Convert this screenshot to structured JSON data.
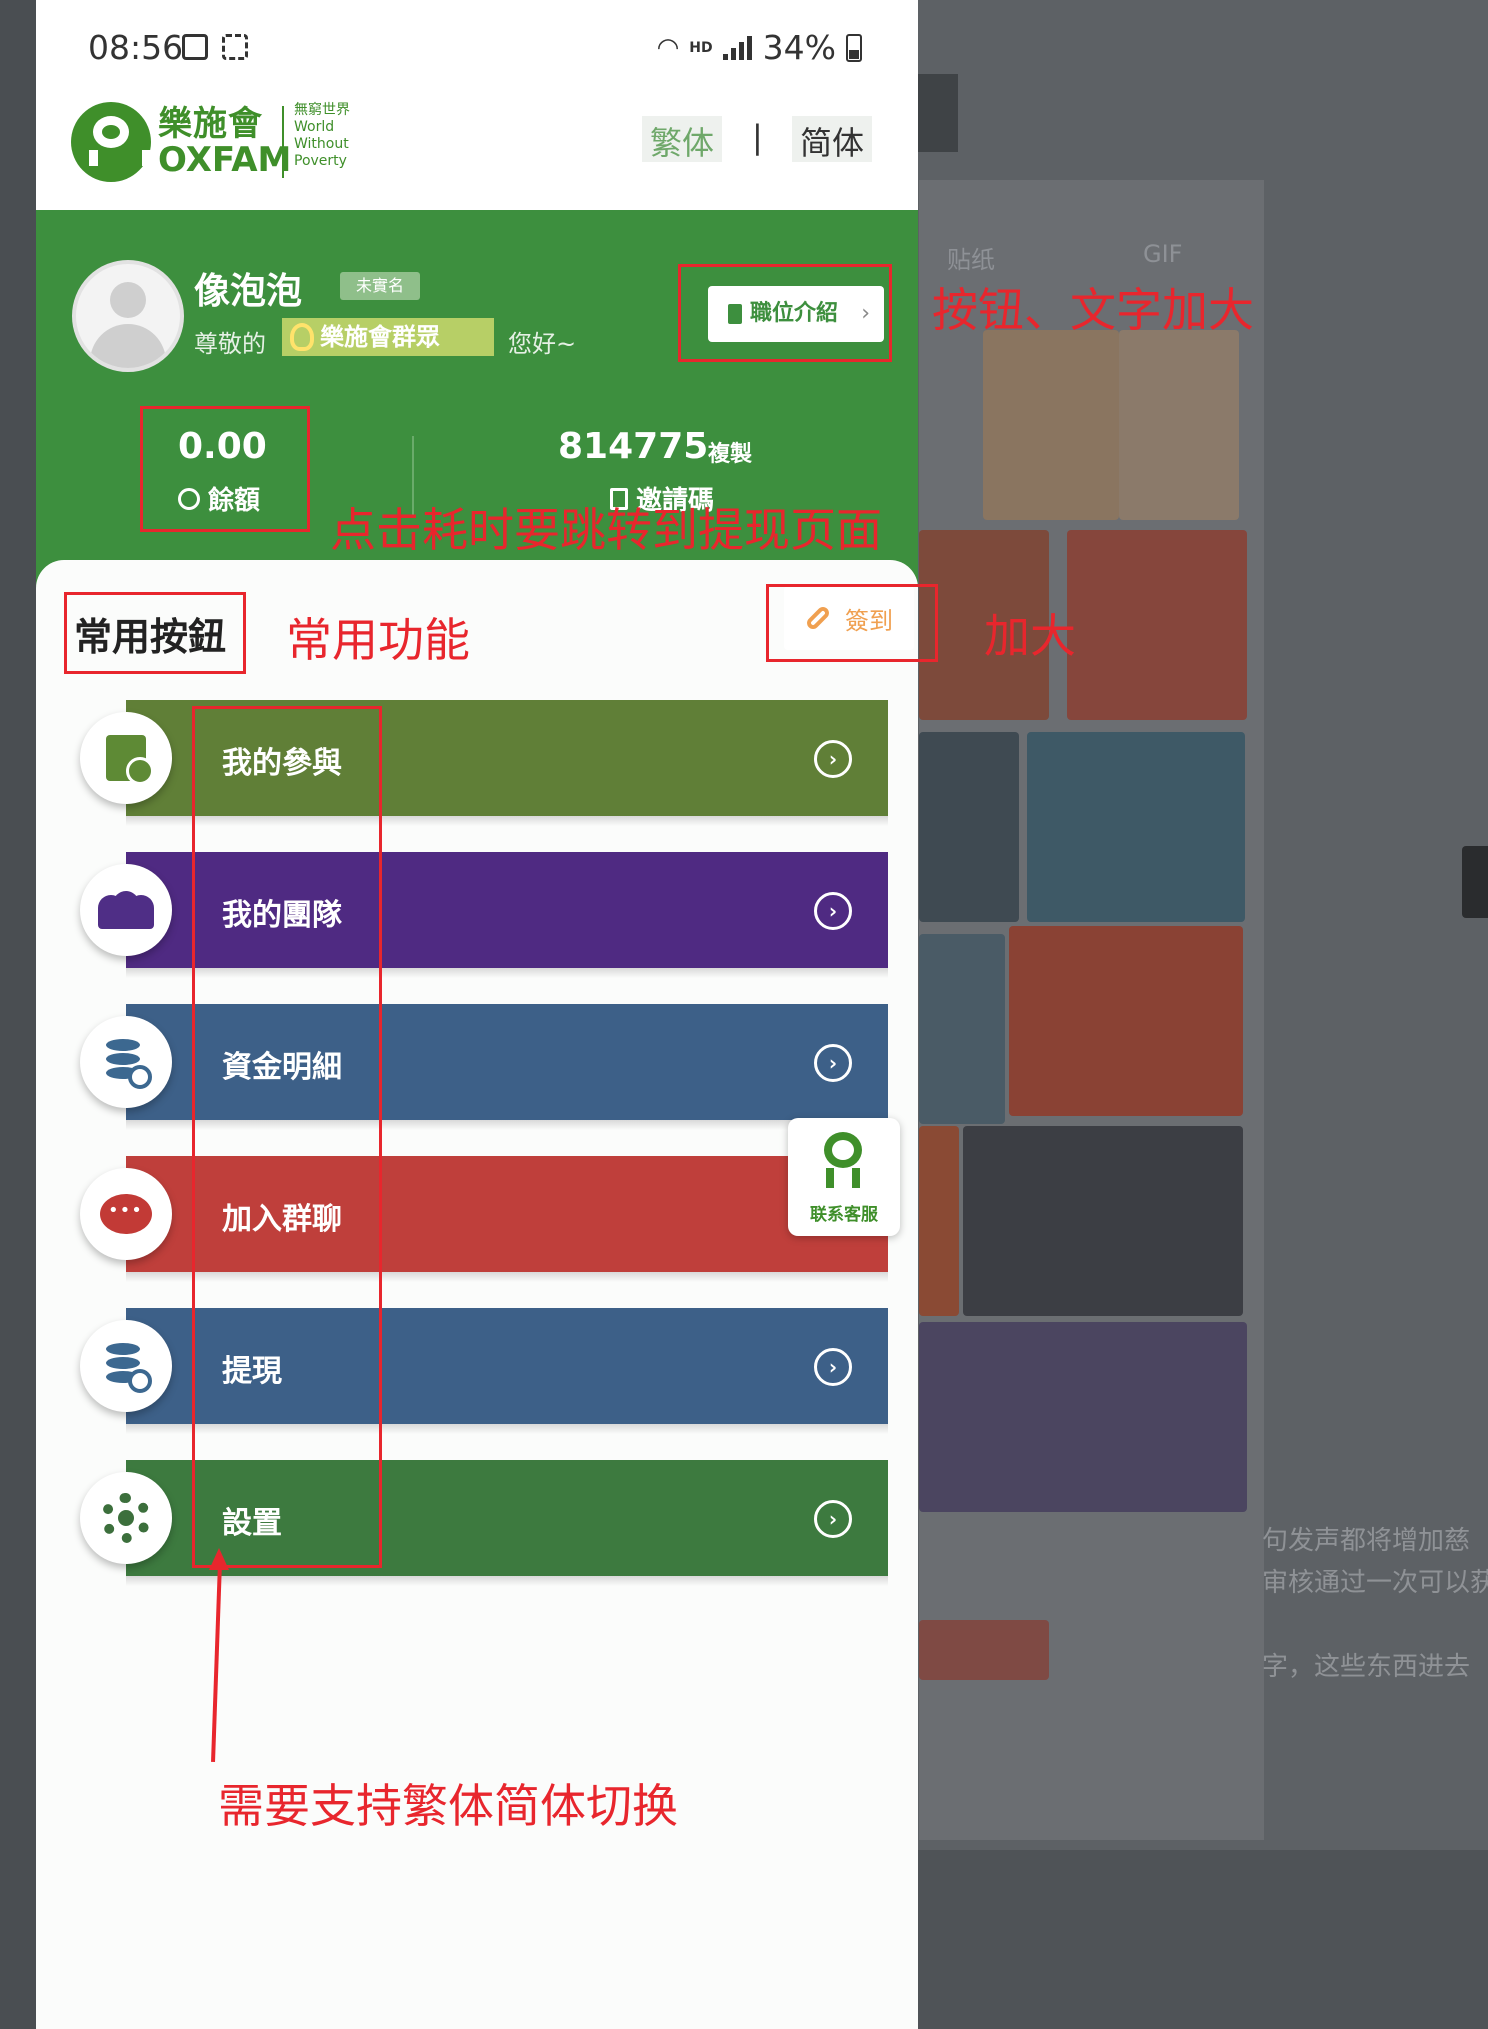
{
  "status_bar": {
    "time": "08:56",
    "hd": "HD",
    "battery": "34%"
  },
  "header": {
    "logo_cn": "樂施會",
    "logo_en": "OXFAM",
    "logo_tagline": [
      "無窮世界",
      "World",
      "Without",
      "Poverty"
    ],
    "lang_traditional": "繁体",
    "lang_separator": "|",
    "lang_simplified": "简体"
  },
  "profile": {
    "name": "像泡泡",
    "verify_badge": "未實名",
    "greeting_prefix": "尊敬的",
    "member_badge": "樂施會群眾",
    "greeting_suffix": "您好~",
    "position_button": "職位介紹",
    "position_chevron": "›"
  },
  "stats": {
    "balance_value": "0.00",
    "balance_label": "餘額",
    "invite_code": "814775",
    "copy_label": "複製",
    "invite_label": "邀請碼"
  },
  "section": {
    "title": "常用按鈕",
    "checkin": "簽到"
  },
  "menu": [
    {
      "label": "我的參與",
      "color": "#607f37",
      "icon": "participation-icon"
    },
    {
      "label": "我的團隊",
      "color": "#4f2a82",
      "icon": "team-icon"
    },
    {
      "label": "資金明細",
      "color": "#3d6088",
      "icon": "funds-detail-icon"
    },
    {
      "label": "加入群聊",
      "color": "#bf3f3b",
      "icon": "group-chat-icon"
    },
    {
      "label": "提現",
      "color": "#3d6088",
      "icon": "withdraw-icon"
    },
    {
      "label": "設置",
      "color": "#3d7a3f",
      "icon": "settings-icon"
    }
  ],
  "menu_go_glyph": "›",
  "support": {
    "label": "联系客服"
  },
  "annotations": {
    "a1": "按钮、文字加大",
    "a2": "点击耗时要跳转到提现页面",
    "a3": "常用功能",
    "a4": "加大",
    "a5": "需要支持繁体简体切换"
  },
  "background": {
    "tab_sticker": "贴纸",
    "tab_gif": "GIF",
    "text_lines": [
      "句发声都将增加慈",
      "审核通过一次可以获",
      "",
      "字，这些东西进去"
    ]
  },
  "colors": {
    "brand_green": "#3d8f3e",
    "annotation_red": "#e8262d",
    "checkin_orange": "#f0a050"
  }
}
